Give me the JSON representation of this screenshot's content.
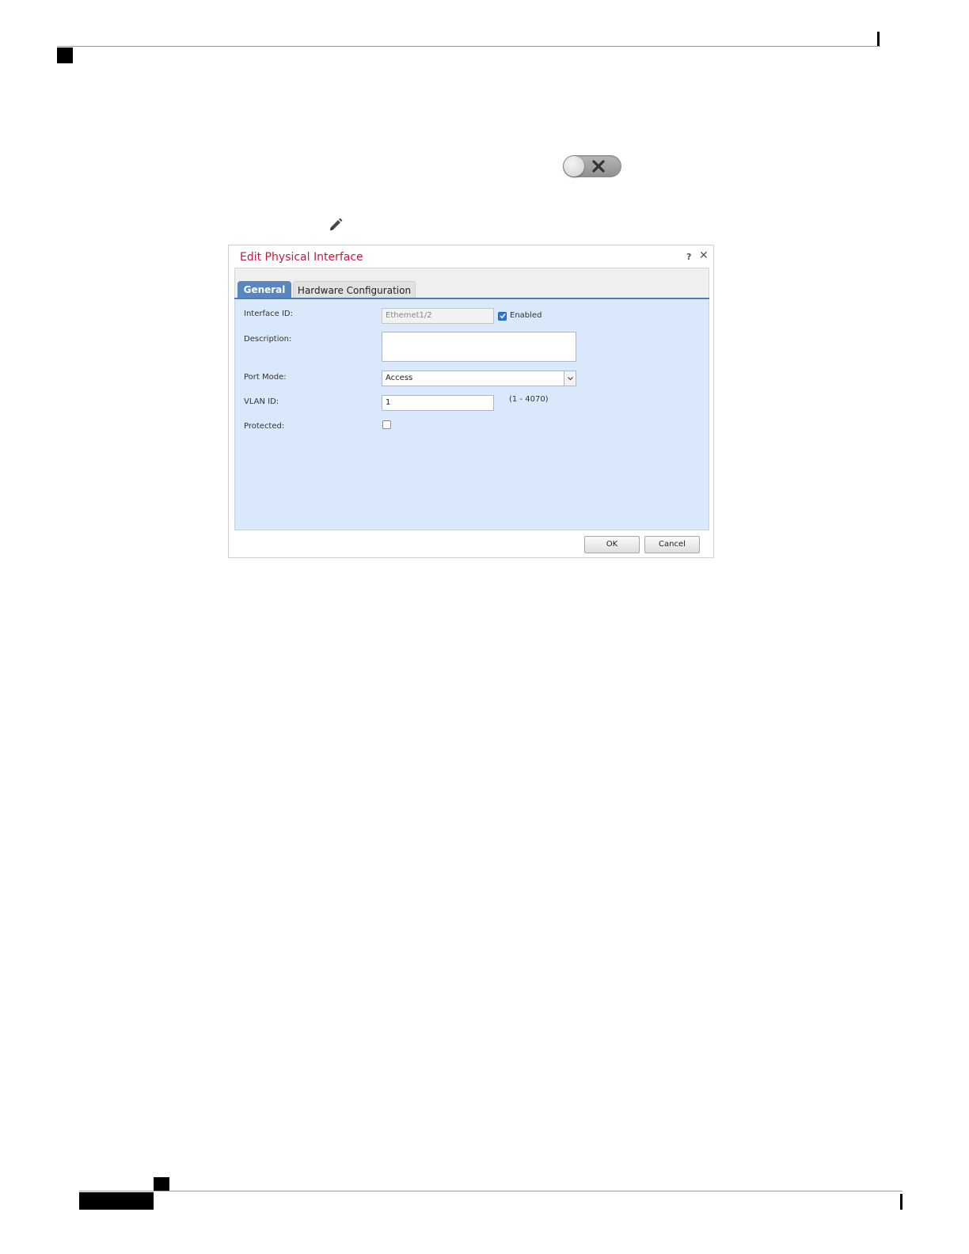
{
  "toggle": {
    "state": "off",
    "icon": "close-x-icon"
  },
  "edit_icon": "pencil-icon",
  "dialog": {
    "title": "Edit Physical Interface",
    "help": "?",
    "close": "✕",
    "tabs": [
      {
        "label": "General",
        "active": true
      },
      {
        "label": "Hardware Configuration",
        "active": false
      }
    ],
    "fields": {
      "interface_id": {
        "label": "Interface ID:",
        "value": "Ethemet1/2",
        "disabled": true
      },
      "enabled": {
        "label": "Enabled",
        "checked": true
      },
      "description": {
        "label": "Description:",
        "value": ""
      },
      "port_mode": {
        "label": "Port Mode:",
        "value": "Access"
      },
      "vlan_id": {
        "label": "VLAN ID:",
        "value": "1",
        "hint": "(1 - 4070)"
      },
      "protected": {
        "label": "Protected:",
        "checked": false
      }
    },
    "buttons": {
      "ok": "OK",
      "cancel": "Cancel"
    }
  },
  "colors": {
    "title": "#c8173c",
    "active_tab": "#5a86be",
    "panel": "#d9e8fb"
  }
}
